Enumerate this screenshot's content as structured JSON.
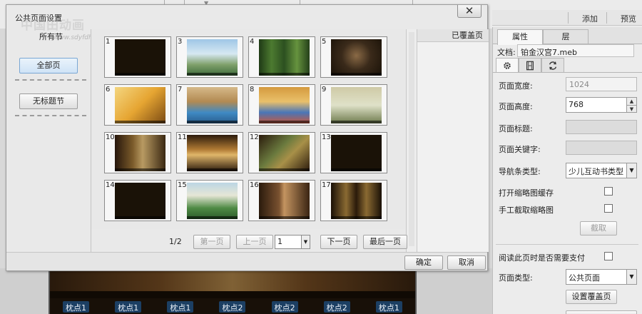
{
  "background": {
    "toolbar": {
      "add_label": "添加",
      "preview_label": "预览"
    },
    "book_nav": [
      "枕点1",
      "枕点1",
      "枕点1",
      "枕点2",
      "枕点2",
      "枕点2",
      "枕点1"
    ]
  },
  "dialog": {
    "title": "公共页面设置",
    "close_glyph": "✕",
    "watermark": {
      "logo": "中国田动画",
      "url": "www.sdyfdh.com"
    },
    "sections": {
      "header": "所有节",
      "items": [
        {
          "label": "全部页",
          "active": true
        },
        {
          "label": "无标题节",
          "active": false
        }
      ]
    },
    "covered_header": "已覆盖页",
    "thumbnails": [
      {
        "num": "1",
        "theme": "dark"
      },
      {
        "num": "3",
        "theme": "city"
      },
      {
        "num": "4",
        "theme": "bamboo"
      },
      {
        "num": "5",
        "theme": "man"
      },
      {
        "num": "6",
        "theme": "gold"
      },
      {
        "num": "7",
        "theme": "pool"
      },
      {
        "num": "8",
        "theme": "lobby"
      },
      {
        "num": "9",
        "theme": "office"
      },
      {
        "num": "10",
        "theme": "lady"
      },
      {
        "num": "11",
        "theme": "street"
      },
      {
        "num": "12",
        "theme": "map"
      },
      {
        "num": "13",
        "theme": "dark"
      },
      {
        "num": "14",
        "theme": "dark"
      },
      {
        "num": "15",
        "theme": "garden"
      },
      {
        "num": "16",
        "theme": "people"
      },
      {
        "num": "17",
        "theme": "door"
      }
    ],
    "pager": {
      "page_indicator": "1/2",
      "first_label": "第一页",
      "prev_label": "上一页",
      "page_value": "1",
      "next_label": "下一页",
      "last_label": "最后一页"
    },
    "ok_label": "确定",
    "cancel_label": "取消"
  },
  "panel": {
    "tabs": [
      {
        "label": "属性",
        "active": true
      },
      {
        "label": "层",
        "active": false
      }
    ],
    "doc_label": "文档:",
    "doc_value": "铂金汉宫7.meb",
    "icon_tabs": [
      "gear-icon",
      "film-icon",
      "refresh-icon"
    ],
    "page_width_label": "页面宽度:",
    "page_width_value": "1024",
    "page_height_label": "页面高度:",
    "page_height_value": "768",
    "page_title_label": "页面标题:",
    "page_title_value": "",
    "page_keywords_label": "页面关键字:",
    "page_keywords_value": "",
    "nav_type_label": "导航条类型:",
    "nav_type_value": "少儿互动书类型",
    "thumb_cache_label": "打开缩略图缓存",
    "manual_thumb_label": "手工截取缩略图",
    "capture_label": "截取",
    "pay_label": "阅读此页时是否需要支付",
    "page_type_label": "页面类型:",
    "page_type_value": "公共页面",
    "set_cover_label": "设置覆盖页"
  }
}
